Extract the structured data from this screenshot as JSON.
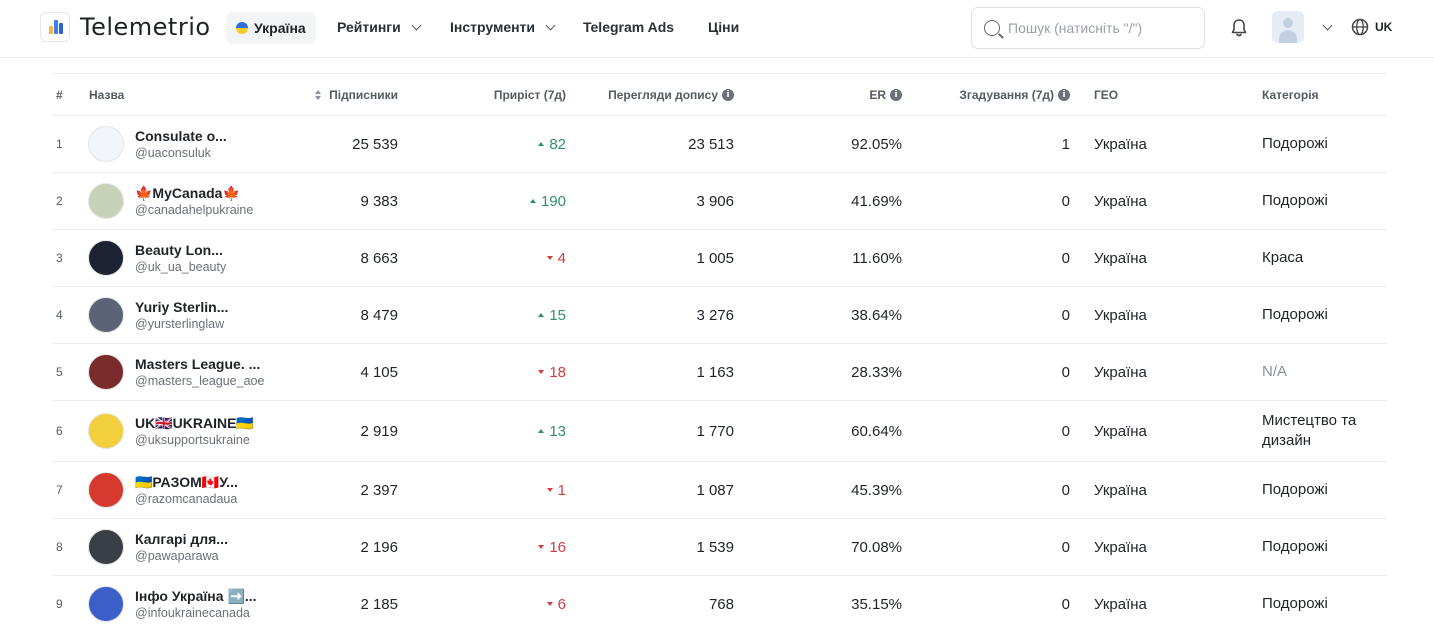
{
  "brand": {
    "name": "Telemetrio"
  },
  "header": {
    "country": "Україна",
    "nav": [
      {
        "label": "Рейтинги",
        "has_dropdown": true
      },
      {
        "label": "Інструменти",
        "has_dropdown": true
      },
      {
        "label": "Telegram Ads",
        "has_dropdown": false
      },
      {
        "label": "Ціни",
        "has_dropdown": false
      }
    ],
    "search_placeholder": "Пошук (натисніть \"/\")",
    "language": "UK"
  },
  "table": {
    "columns": {
      "rank": "#",
      "name": "Назва",
      "subscribers": "Підписники",
      "growth": "Приріст (7д)",
      "views": "Перегляди допису",
      "er": "ER",
      "mentions": "Згадування (7д)",
      "geo": "ГЕО",
      "category": "Категорія"
    },
    "rows": [
      {
        "rank": "1",
        "title": "Consulate o...",
        "handle": "@uaconsuluk",
        "subscribers": "25 539",
        "growth": "82",
        "growth_dir": "up",
        "views": "23 513",
        "er": "92.05%",
        "mentions": "1",
        "geo": "Україна",
        "category": "Подорожі",
        "avatar_color": "#f2f6fb"
      },
      {
        "rank": "2",
        "title": "🍁MyCanada🍁",
        "handle": "@canadahelpukraine",
        "subscribers": "9 383",
        "growth": "190",
        "growth_dir": "up",
        "views": "3 906",
        "er": "41.69%",
        "mentions": "0",
        "geo": "Україна",
        "category": "Подорожі",
        "avatar_color": "#c8d2b8"
      },
      {
        "rank": "3",
        "title": "Beauty Lon...",
        "handle": "@uk_ua_beauty",
        "subscribers": "8 663",
        "growth": "4",
        "growth_dir": "down",
        "views": "1 005",
        "er": "11.60%",
        "mentions": "0",
        "geo": "Україна",
        "category": "Краса",
        "avatar_color": "#1d2333"
      },
      {
        "rank": "4",
        "title": "Yuriy Sterlin...",
        "handle": "@yursterlinglaw",
        "subscribers": "8 479",
        "growth": "15",
        "growth_dir": "up",
        "views": "3 276",
        "er": "38.64%",
        "mentions": "0",
        "geo": "Україна",
        "category": "Подорожі",
        "avatar_color": "#5a6476"
      },
      {
        "rank": "5",
        "title": "Masters League. ...",
        "handle": "@masters_league_aoe",
        "subscribers": "4 105",
        "growth": "18",
        "growth_dir": "down",
        "views": "1 163",
        "er": "28.33%",
        "mentions": "0",
        "geo": "Україна",
        "category": "N/A",
        "avatar_color": "#7a2b2b"
      },
      {
        "rank": "6",
        "title": "UK🇬🇧UKRAINE🇺🇦",
        "handle": "@uksupportsukraine",
        "subscribers": "2 919",
        "growth": "13",
        "growth_dir": "up",
        "views": "1 770",
        "er": "60.64%",
        "mentions": "0",
        "geo": "Україна",
        "category": "Мистецтво та дизайн",
        "avatar_color": "#f2cf3c"
      },
      {
        "rank": "7",
        "title": "🇺🇦РАЗОМ🇨🇦У...",
        "handle": "@razomcanadaua",
        "subscribers": "2 397",
        "growth": "1",
        "growth_dir": "down",
        "views": "1 087",
        "er": "45.39%",
        "mentions": "0",
        "geo": "Україна",
        "category": "Подорожі",
        "avatar_color": "#d63a2f"
      },
      {
        "rank": "8",
        "title": "Калгарі для...",
        "handle": "@pawaparawa",
        "subscribers": "2 196",
        "growth": "16",
        "growth_dir": "down",
        "views": "1 539",
        "er": "70.08%",
        "mentions": "0",
        "geo": "Україна",
        "category": "Подорожі",
        "avatar_color": "#3a3f45"
      },
      {
        "rank": "9",
        "title": "Інфо Україна ➡️...",
        "handle": "@infoukrainecanada",
        "subscribers": "2 185",
        "growth": "6",
        "growth_dir": "down",
        "views": "768",
        "er": "35.15%",
        "mentions": "0",
        "geo": "Україна",
        "category": "Подорожі",
        "avatar_color": "#3b5ec9"
      }
    ]
  }
}
